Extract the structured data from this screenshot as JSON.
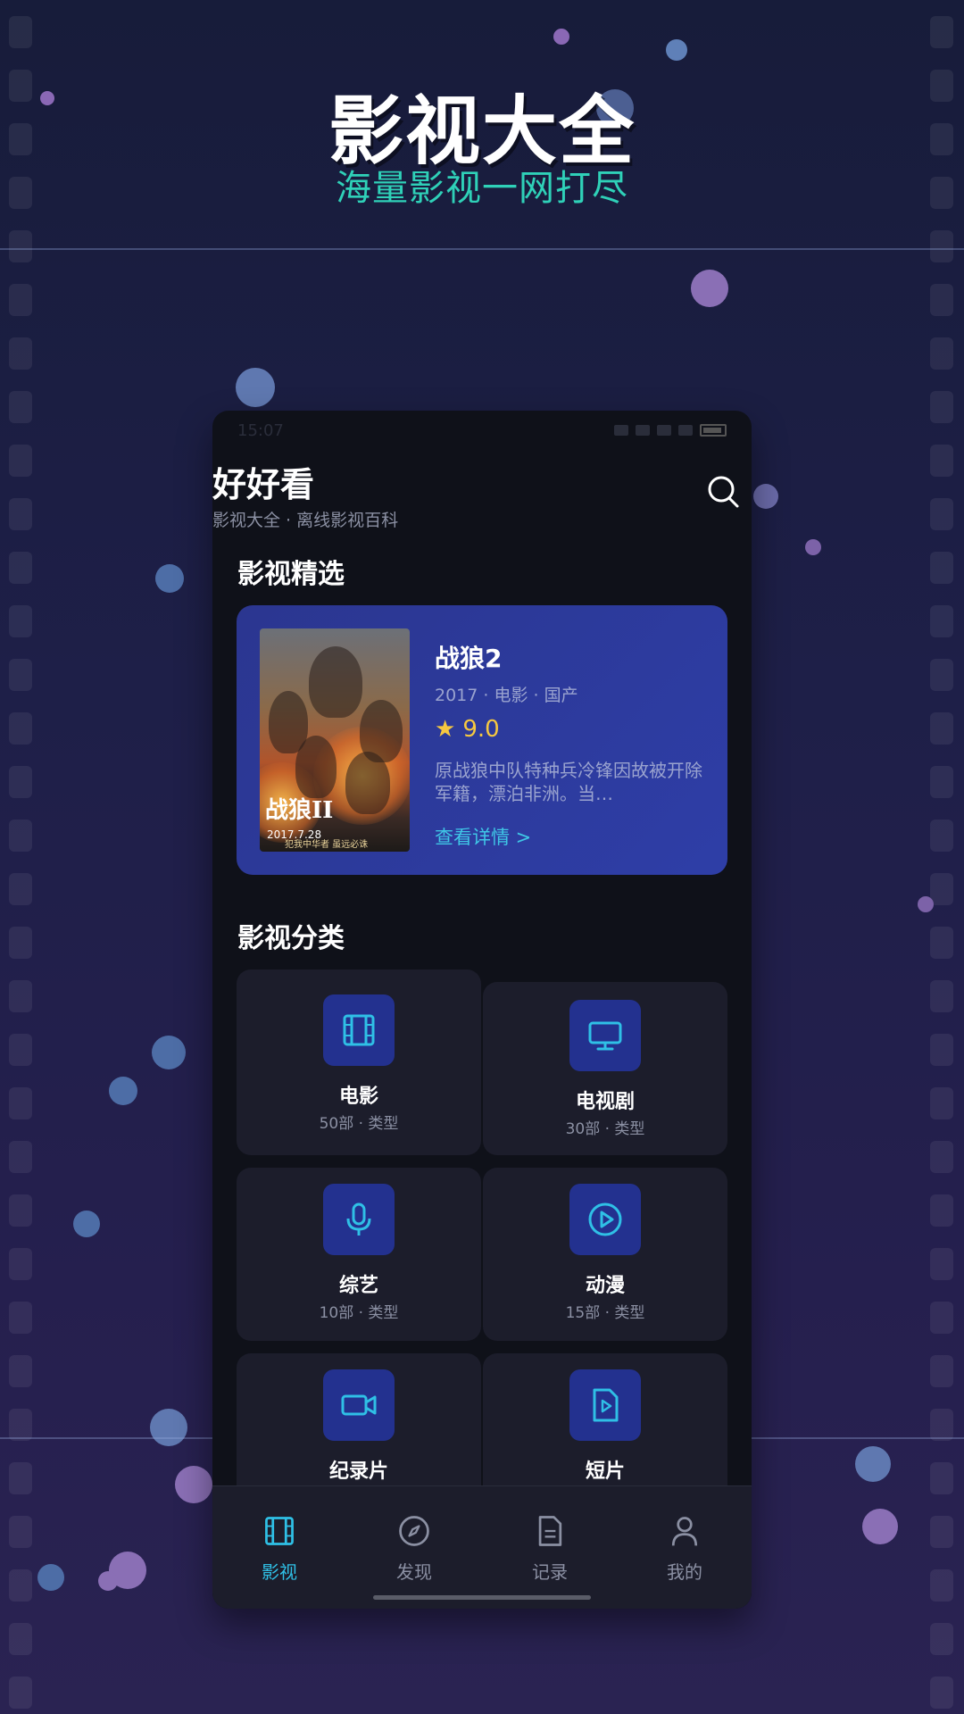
{
  "hero": {
    "title": "影视大全",
    "subtitle": "海量影视一网打尽"
  },
  "status_bar": {
    "time": "15:07"
  },
  "app": {
    "title": "好好看",
    "subtitle": "影视大全 · 离线影视百科"
  },
  "featured": {
    "section_title": "影视精选",
    "title": "战狼2",
    "meta": "2017 · 电影 · 国产",
    "rating": "9.0",
    "description": "原战狼中队特种兵冷锋因故被开除军籍，漂泊非洲。当…",
    "link": "查看详情 >",
    "poster_text": "战狼II",
    "poster_date": "2017.7.28",
    "poster_tag": "犯我中华者 虽远必诛"
  },
  "categories": {
    "section_title": "影视分类",
    "items": [
      {
        "name": "电影",
        "meta": "50部 · 类型",
        "icon": "film-icon"
      },
      {
        "name": "电视剧",
        "meta": "30部 · 类型",
        "icon": "tv-icon"
      },
      {
        "name": "综艺",
        "meta": "10部 · 类型",
        "icon": "microphone-icon"
      },
      {
        "name": "动漫",
        "meta": "15部 · 类型",
        "icon": "play-circle-icon"
      },
      {
        "name": "纪录片",
        "meta": "",
        "icon": "video-camera-icon"
      },
      {
        "name": "短片",
        "meta": "",
        "icon": "video-file-icon"
      }
    ]
  },
  "tabs": [
    {
      "label": "影视",
      "icon": "film-icon",
      "active": true
    },
    {
      "label": "发现",
      "icon": "compass-icon",
      "active": false
    },
    {
      "label": "记录",
      "icon": "document-icon",
      "active": false
    },
    {
      "label": "我的",
      "icon": "user-icon",
      "active": false
    }
  ],
  "colors": {
    "accent": "#2fc0e6",
    "hero_subtitle": "#2fd1b8",
    "card_bg": "#2e3ea7",
    "rating": "#f5c840"
  }
}
